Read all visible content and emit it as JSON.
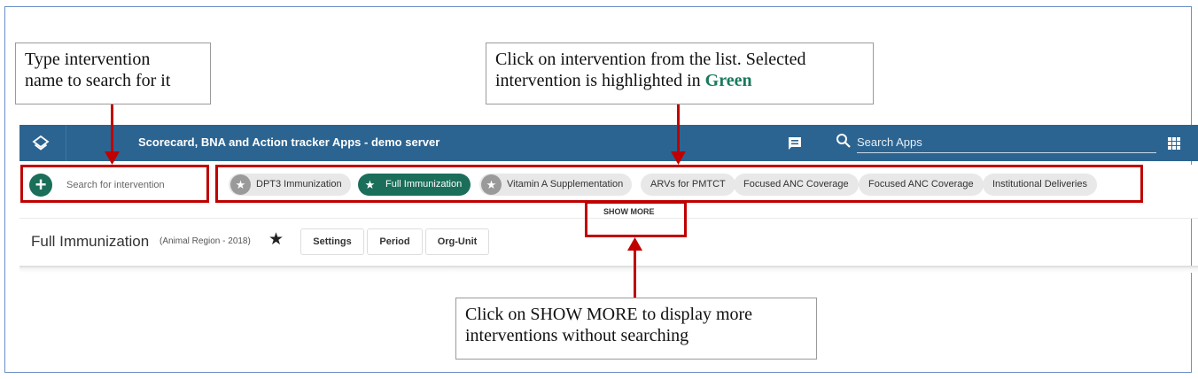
{
  "annotations": {
    "search_hint": [
      "Type intervention",
      "name to search for it"
    ],
    "click_hint_line1": "Click on intervention from the list. Selected",
    "click_hint_line2_prefix": "intervention is highlighted in ",
    "click_hint_highlight": "Green",
    "showmore_hint": [
      "Click on SHOW MORE to display more",
      "interventions without searching"
    ],
    "highlight_color": "#1a7a5e",
    "arrow_color": "#c00000"
  },
  "header": {
    "title": "Scorecard, BNA and Action tracker Apps - demo server",
    "search_placeholder": "Search Apps",
    "bar_color": "#2c6491"
  },
  "interventions": {
    "add_icon": "+",
    "search_placeholder": "Search for intervention",
    "chips": [
      {
        "label": "DPT3 Immunization",
        "starred": true,
        "selected": false
      },
      {
        "label": "Full Immunization",
        "starred": true,
        "selected": true
      },
      {
        "label": "Vitamin A Supplementation",
        "starred": true,
        "selected": false
      },
      {
        "label": "ARVs for PMTCT",
        "starred": false,
        "selected": false
      },
      {
        "label": "Focused ANC Coverage",
        "starred": false,
        "selected": false
      },
      {
        "label": "Focused ANC Coverage",
        "starred": false,
        "selected": false
      },
      {
        "label": "Institutional Deliveries",
        "starred": false,
        "selected": false
      }
    ],
    "selected_color": "#1a6e5a",
    "show_more": "SHOW MORE"
  },
  "main": {
    "title": "Full Immunization",
    "subtitle": "(Animal Region - 2018)",
    "star": "★",
    "buttons": {
      "settings": "Settings",
      "period": "Period",
      "org_unit": "Org-Unit"
    }
  }
}
